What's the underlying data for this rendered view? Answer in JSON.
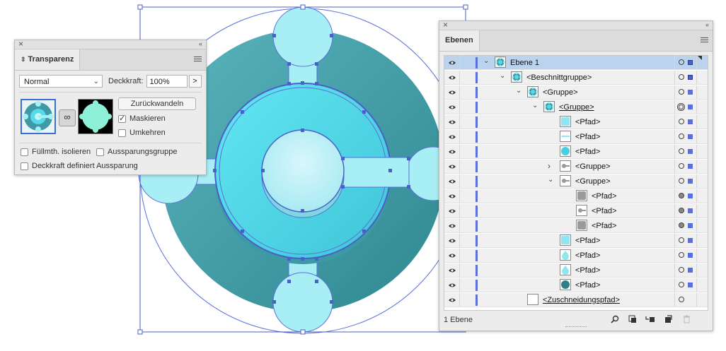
{
  "transparency_panel": {
    "title": "Transparenz",
    "blend_mode": "Normal",
    "opacity_label": "Deckkraft:",
    "opacity_value": "100%",
    "opacity_step_button": ">",
    "release_button": "Zurückwandeln",
    "clip_label": "Maskieren",
    "clip_checked": true,
    "invert_label": "Umkehren",
    "invert_checked": false,
    "isolate_label": "Füllmth. isolieren",
    "isolate_checked": false,
    "knockout_label": "Aussparungsgruppe",
    "knockout_checked": false,
    "opacity_knockout_label": "Deckkraft definiert Aussparung",
    "opacity_knockout_checked": false,
    "close_glyph": "×",
    "collapse_glyph": "‹‹",
    "link_glyph": "∞"
  },
  "layers_panel": {
    "title": "Ebenen",
    "close_glyph": "×",
    "collapse_glyph": "‹‹",
    "footer_count": "1 Ebene",
    "rows": [
      {
        "name": "Ebene 1",
        "selected": true,
        "twirl": "open",
        "underline": false,
        "thumb": "layer"
      },
      {
        "name": "<Beschnittgruppe>",
        "selected": false,
        "twirl": "open",
        "underline": false,
        "thumb": "layer"
      },
      {
        "name": "<Gruppe>",
        "selected": false,
        "twirl": "open",
        "underline": false,
        "thumb": "layer"
      },
      {
        "name": "<Gruppe>",
        "selected": false,
        "twirl": "open",
        "underline": true,
        "thumb": "layer"
      },
      {
        "name": "<Pfad>",
        "selected": false,
        "twirl": "none",
        "underline": false,
        "thumb": "light-square"
      },
      {
        "name": "<Pfad>",
        "selected": false,
        "twirl": "none",
        "underline": false,
        "thumb": "light-bar"
      },
      {
        "name": "<Pfad>",
        "selected": false,
        "twirl": "none",
        "underline": false,
        "thumb": "cyan-circle"
      },
      {
        "name": "<Gruppe>",
        "selected": false,
        "twirl": "closed",
        "underline": false,
        "thumb": "gray-key"
      },
      {
        "name": "<Gruppe>",
        "selected": false,
        "twirl": "open",
        "underline": false,
        "thumb": "gray-key"
      },
      {
        "name": "<Pfad>",
        "selected": false,
        "twirl": "none",
        "underline": false,
        "thumb": "gray-square"
      },
      {
        "name": "<Pfad>",
        "selected": false,
        "twirl": "none",
        "underline": false,
        "thumb": "gray-key"
      },
      {
        "name": "<Pfad>",
        "selected": false,
        "twirl": "none",
        "underline": false,
        "thumb": "gray-square"
      },
      {
        "name": "<Pfad>",
        "selected": false,
        "twirl": "none",
        "underline": false,
        "thumb": "light-square"
      },
      {
        "name": "<Pfad>",
        "selected": false,
        "twirl": "none",
        "underline": false,
        "thumb": "light-drop"
      },
      {
        "name": "<Pfad>",
        "selected": false,
        "twirl": "none",
        "underline": false,
        "thumb": "light-drop"
      },
      {
        "name": "<Pfad>",
        "selected": false,
        "twirl": "none",
        "underline": false,
        "thumb": "teal-circle"
      },
      {
        "name": "<Zuschneidungspfad>",
        "selected": false,
        "twirl": "none",
        "underline": true,
        "thumb": "white-square"
      }
    ]
  },
  "colors": {
    "accent_blue": "#5b6fd9",
    "teal_dark": "#3f9aa5",
    "cyan_light": "#a8eef5",
    "cyan_mid": "#55dbe8",
    "selection_row": "#bcd3ee"
  }
}
